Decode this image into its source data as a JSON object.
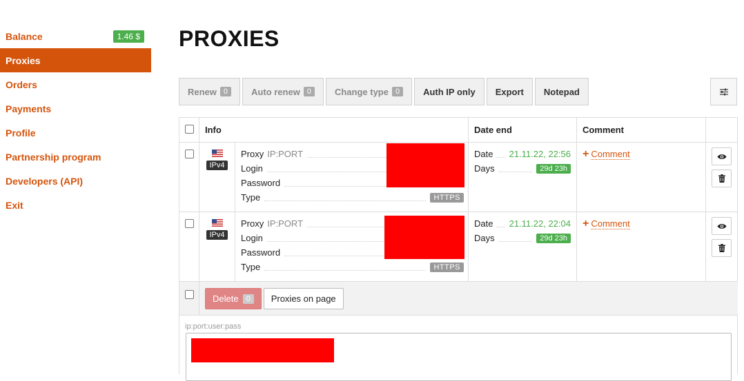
{
  "sidebar": {
    "items": [
      {
        "label": "Balance",
        "badge": "1.46 $"
      },
      {
        "label": "Proxies"
      },
      {
        "label": "Orders"
      },
      {
        "label": "Payments"
      },
      {
        "label": "Profile"
      },
      {
        "label": "Partnership program"
      },
      {
        "label": "Developers (API)"
      },
      {
        "label": "Exit"
      }
    ]
  },
  "page": {
    "title": "PROXIES"
  },
  "toolbar": {
    "renew": "Renew",
    "renew_count": "0",
    "auto_renew": "Auto renew",
    "auto_renew_count": "0",
    "change_type": "Change type",
    "change_type_count": "0",
    "auth_ip": "Auth IP only",
    "export": "Export",
    "notepad": "Notepad",
    "settings_icon": "sliders-icon"
  },
  "table": {
    "headers": {
      "info": "Info",
      "date_end": "Date end",
      "comment": "Comment"
    },
    "rows": [
      {
        "flag": "us-flag-icon",
        "ip_version": "IPv4",
        "proxy_label": "Proxy",
        "proxy_hint": "IP:PORT",
        "login_label": "Login",
        "password_label": "Password",
        "type_label": "Type",
        "type_value": "HTTPS",
        "date_label": "Date",
        "date_value": "21.11.22, 22:56",
        "days_label": "Days",
        "days_value": "29d 23h",
        "comment_label": "Comment"
      },
      {
        "flag": "us-flag-icon",
        "ip_version": "IPv4",
        "proxy_label": "Proxy",
        "proxy_hint": "IP:PORT",
        "login_label": "Login",
        "password_label": "Password",
        "type_label": "Type",
        "type_value": "HTTPS",
        "date_label": "Date",
        "date_value": "21.11.22, 22:04",
        "days_label": "Days",
        "days_value": "29d 23h",
        "comment_label": "Comment"
      }
    ],
    "footer": {
      "delete": "Delete",
      "delete_count": "0",
      "per_page": "Proxies on page"
    }
  },
  "export_area": {
    "format_label": "ip:port:user:pass"
  },
  "colors": {
    "accent": "#d4540c",
    "success": "#4cae4c",
    "redaction": "#ff0000"
  }
}
